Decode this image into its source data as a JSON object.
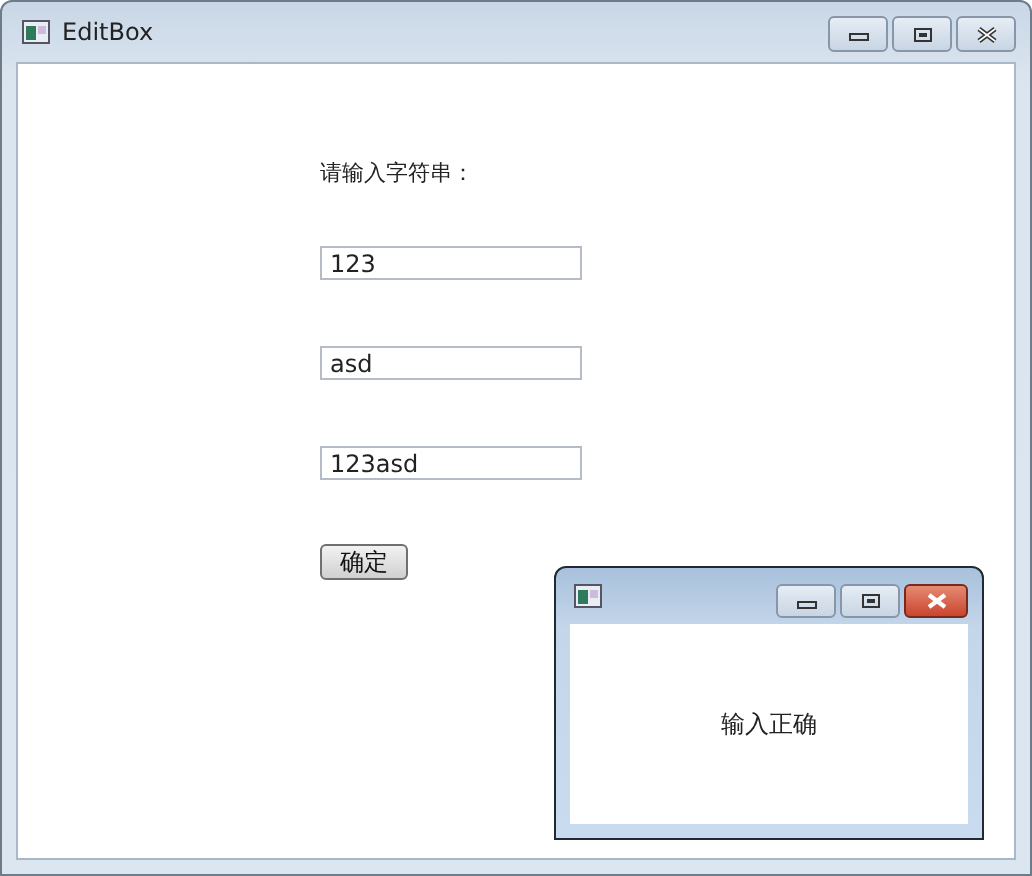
{
  "window": {
    "title": "EditBox"
  },
  "prompt": "请输入字符串：",
  "fields": [
    {
      "value": "123"
    },
    {
      "value": "asd"
    },
    {
      "value": "123asd"
    }
  ],
  "confirm_button": "确定",
  "dialog": {
    "message": "输入正确"
  }
}
